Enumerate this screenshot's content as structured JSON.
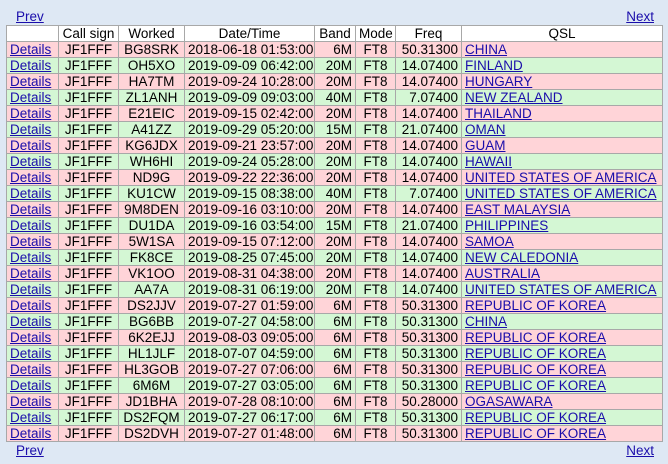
{
  "nav": {
    "prev": "Prev",
    "next": "Next"
  },
  "headers": [
    "",
    "Call sign",
    "Worked",
    "Date/Time",
    "Band",
    "Mode",
    "Freq",
    "QSL"
  ],
  "details_label": "Details",
  "row_colors": {
    "pink": "#ffd4d8",
    "green": "#d4f7d4"
  },
  "rows": [
    {
      "call": "JF1FFF",
      "worked": "BG8SRK",
      "dt": "2018-06-18 01:53:00",
      "band": "6M",
      "mode": "FT8",
      "freq": "50.31300",
      "qsl": "CHINA",
      "color": "pink"
    },
    {
      "call": "JF1FFF",
      "worked": "OH5XO",
      "dt": "2019-09-09 06:42:00",
      "band": "20M",
      "mode": "FT8",
      "freq": "14.07400",
      "qsl": "FINLAND",
      "color": "green"
    },
    {
      "call": "JF1FFF",
      "worked": "HA7TM",
      "dt": "2019-09-24 10:28:00",
      "band": "20M",
      "mode": "FT8",
      "freq": "14.07400",
      "qsl": "HUNGARY",
      "color": "pink"
    },
    {
      "call": "JF1FFF",
      "worked": "ZL1ANH",
      "dt": "2019-09-09 09:03:00",
      "band": "40M",
      "mode": "FT8",
      "freq": "7.07400",
      "qsl": "NEW ZEALAND",
      "color": "green"
    },
    {
      "call": "JF1FFF",
      "worked": "E21EIC",
      "dt": "2019-09-15 02:42:00",
      "band": "20M",
      "mode": "FT8",
      "freq": "14.07400",
      "qsl": "THAILAND",
      "color": "pink"
    },
    {
      "call": "JF1FFF",
      "worked": "A41ZZ",
      "dt": "2019-09-29 05:20:00",
      "band": "15M",
      "mode": "FT8",
      "freq": "21.07400",
      "qsl": "OMAN",
      "color": "green"
    },
    {
      "call": "JF1FFF",
      "worked": "KG6JDX",
      "dt": "2019-09-21 23:57:00",
      "band": "20M",
      "mode": "FT8",
      "freq": "14.07400",
      "qsl": "GUAM",
      "color": "pink"
    },
    {
      "call": "JF1FFF",
      "worked": "WH6HI",
      "dt": "2019-09-24 05:28:00",
      "band": "20M",
      "mode": "FT8",
      "freq": "14.07400",
      "qsl": "HAWAII",
      "color": "green"
    },
    {
      "call": "JF1FFF",
      "worked": "ND9G",
      "dt": "2019-09-22 22:36:00",
      "band": "20M",
      "mode": "FT8",
      "freq": "14.07400",
      "qsl": "UNITED STATES OF AMERICA",
      "color": "pink"
    },
    {
      "call": "JF1FFF",
      "worked": "KU1CW",
      "dt": "2019-09-15 08:38:00",
      "band": "40M",
      "mode": "FT8",
      "freq": "7.07400",
      "qsl": "UNITED STATES OF AMERICA",
      "color": "green"
    },
    {
      "call": "JF1FFF",
      "worked": "9M8DEN",
      "dt": "2019-09-16 03:10:00",
      "band": "20M",
      "mode": "FT8",
      "freq": "14.07400",
      "qsl": "EAST MALAYSIA",
      "color": "pink"
    },
    {
      "call": "JF1FFF",
      "worked": "DU1DA",
      "dt": "2019-09-16 03:54:00",
      "band": "15M",
      "mode": "FT8",
      "freq": "21.07400",
      "qsl": "PHILIPPINES",
      "color": "green"
    },
    {
      "call": "JF1FFF",
      "worked": "5W1SA",
      "dt": "2019-09-15 07:12:00",
      "band": "20M",
      "mode": "FT8",
      "freq": "14.07400",
      "qsl": "SAMOA",
      "color": "pink"
    },
    {
      "call": "JF1FFF",
      "worked": "FK8CE",
      "dt": "2019-08-25 07:45:00",
      "band": "20M",
      "mode": "FT8",
      "freq": "14.07400",
      "qsl": "NEW CALEDONIA",
      "color": "green"
    },
    {
      "call": "JF1FFF",
      "worked": "VK1OO",
      "dt": "2019-08-31 04:38:00",
      "band": "20M",
      "mode": "FT8",
      "freq": "14.07400",
      "qsl": "AUSTRALIA",
      "color": "pink"
    },
    {
      "call": "JF1FFF",
      "worked": "AA7A",
      "dt": "2019-08-31 06:19:00",
      "band": "20M",
      "mode": "FT8",
      "freq": "14.07400",
      "qsl": "UNITED STATES OF AMERICA",
      "color": "green"
    },
    {
      "call": "JF1FFF",
      "worked": "DS2JJV",
      "dt": "2019-07-27 01:59:00",
      "band": "6M",
      "mode": "FT8",
      "freq": "50.31300",
      "qsl": "REPUBLIC OF KOREA",
      "color": "pink"
    },
    {
      "call": "JF1FFF",
      "worked": "BG6BB",
      "dt": "2019-07-27 04:58:00",
      "band": "6M",
      "mode": "FT8",
      "freq": "50.31300",
      "qsl": "CHINA",
      "color": "green"
    },
    {
      "call": "JF1FFF",
      "worked": "6K2EJJ",
      "dt": "2019-08-03 09:05:00",
      "band": "6M",
      "mode": "FT8",
      "freq": "50.31300",
      "qsl": "REPUBLIC OF KOREA",
      "color": "pink"
    },
    {
      "call": "JF1FFF",
      "worked": "HL1JLF",
      "dt": "2018-07-07 04:59:00",
      "band": "6M",
      "mode": "FT8",
      "freq": "50.31300",
      "qsl": "REPUBLIC OF KOREA",
      "color": "green"
    },
    {
      "call": "JF1FFF",
      "worked": "HL3GOB",
      "dt": "2019-07-27 07:06:00",
      "band": "6M",
      "mode": "FT8",
      "freq": "50.31300",
      "qsl": "REPUBLIC OF KOREA",
      "color": "pink"
    },
    {
      "call": "JF1FFF",
      "worked": "6M6M",
      "dt": "2019-07-27 03:05:00",
      "band": "6M",
      "mode": "FT8",
      "freq": "50.31300",
      "qsl": "REPUBLIC OF KOREA",
      "color": "green"
    },
    {
      "call": "JF1FFF",
      "worked": "JD1BHA",
      "dt": "2019-07-28 08:10:00",
      "band": "6M",
      "mode": "FT8",
      "freq": "50.28000",
      "qsl": "OGASAWARA",
      "color": "pink"
    },
    {
      "call": "JF1FFF",
      "worked": "DS2FQM",
      "dt": "2019-07-27 06:17:00",
      "band": "6M",
      "mode": "FT8",
      "freq": "50.31300",
      "qsl": "REPUBLIC OF KOREA",
      "color": "green"
    },
    {
      "call": "JF1FFF",
      "worked": "DS2DVH",
      "dt": "2019-07-27 01:48:00",
      "band": "6M",
      "mode": "FT8",
      "freq": "50.31300",
      "qsl": "REPUBLIC OF KOREA",
      "color": "pink"
    }
  ]
}
